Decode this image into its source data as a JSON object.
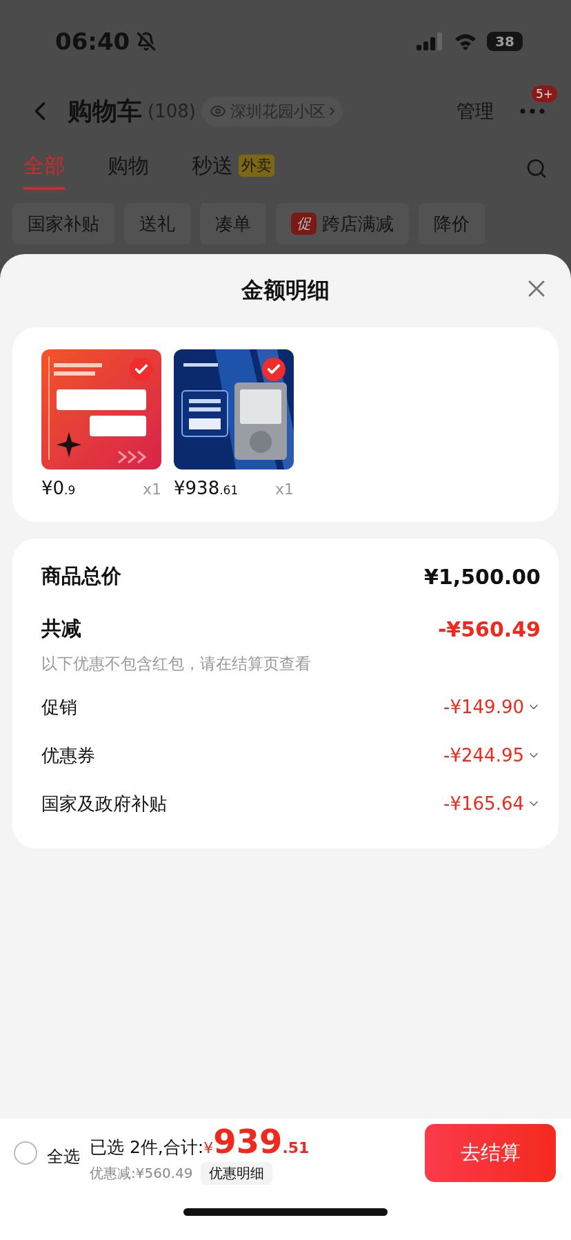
{
  "status_bar": {
    "time": "06:40",
    "battery": "38"
  },
  "header": {
    "title": "购物车",
    "count": "(108)",
    "location": "深圳花园小区",
    "manage": "管理",
    "badge": "5+"
  },
  "tabs": [
    {
      "label": "全部",
      "selected": true
    },
    {
      "label": "购物",
      "selected": false
    },
    {
      "label": "秒送",
      "selected": false,
      "tag": "外卖"
    }
  ],
  "filters": [
    {
      "label": "国家补贴"
    },
    {
      "label": "送礼"
    },
    {
      "label": "凑单"
    },
    {
      "label": "跨店满减",
      "tag": "促"
    },
    {
      "label": "降价"
    }
  ],
  "sheet": {
    "title": "金额明细",
    "products": [
      {
        "kind": "picture",
        "checked": true,
        "price": "¥0",
        "price_decimal": ".9",
        "quantity": "x1"
      },
      {
        "kind": "picture",
        "checked": true,
        "price": "¥938",
        "price_decimal": ".61",
        "quantity": "x1"
      }
    ],
    "total": {
      "label": "商品总价",
      "value": "¥1,500.00"
    },
    "discount": {
      "label": "共减",
      "value": "-¥560.49",
      "note": "以下优惠不包含红包，请在结算页查看"
    },
    "items": [
      {
        "label": "促销",
        "value": "-¥149.90"
      },
      {
        "label": "优惠券",
        "value": "-¥244.95"
      },
      {
        "label": "国家及政府补贴",
        "value": "-¥165.64"
      }
    ]
  },
  "footer": {
    "select_all": {
      "label": "全选",
      "checked": false
    },
    "summary": "已选 2件,合计:",
    "currency": "¥",
    "total": "939",
    "total_decimal": ".51",
    "saved": "优惠减:¥560.49",
    "details_button": "优惠明细",
    "checkout": "去结算"
  }
}
